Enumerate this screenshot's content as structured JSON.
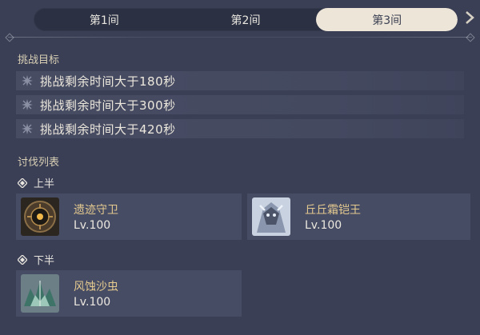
{
  "tabs": [
    {
      "label": "第1间",
      "active": false
    },
    {
      "label": "第2间",
      "active": false
    },
    {
      "label": "第3间",
      "active": true
    }
  ],
  "challenge": {
    "title": "挑战目标",
    "goals": [
      "挑战剩余时间大于180秒",
      "挑战剩余时间大于300秒",
      "挑战剩余时间大于420秒"
    ]
  },
  "enemies": {
    "title": "讨伐列表",
    "upper": {
      "label": "上半",
      "items": [
        {
          "name": "遗迹守卫",
          "level": "Lv.100",
          "icon": "ruin-guard-portrait"
        },
        {
          "name": "丘丘霜铠王",
          "level": "Lv.100",
          "icon": "frost-lawachurl-portrait"
        }
      ]
    },
    "lower": {
      "label": "下半",
      "items": [
        {
          "name": "风蚀沙虫",
          "level": "Lv.100",
          "icon": "sandworm-portrait"
        }
      ]
    }
  },
  "colors": {
    "accent_tab": "#ece5d8",
    "name_gold": "#e3c98e",
    "panel": "#474c65"
  }
}
